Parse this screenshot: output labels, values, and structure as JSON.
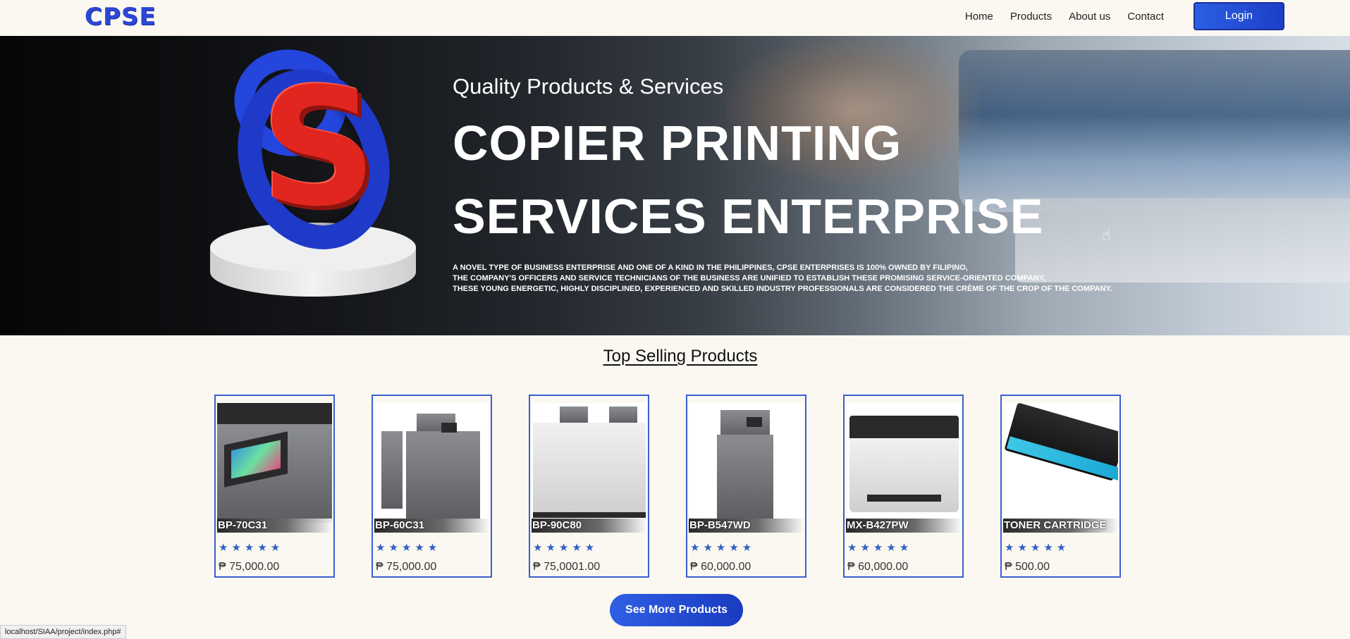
{
  "brand": {
    "logo_text": "CPSE"
  },
  "nav": {
    "links": [
      "Home",
      "Products",
      "About us",
      "Contact"
    ],
    "login_label": "Login"
  },
  "hero": {
    "subtitle": "Quality Products & Services",
    "title_line1": "COPIER PRINTING",
    "title_line2": "SERVICES ENTERPRISE",
    "description": [
      "A NOVEL TYPE OF BUSINESS ENTERPRISE AND ONE OF A KIND IN THE PHILIPPINES, CPSE ENTERPRISES IS 100% OWNED BY FILIPINO,",
      "THE COMPANY'S OFFICERS AND SERVICE TECHNICIANS OF THE BUSINESS ARE UNIFIED TO ESTABLISH THESE PROMISING SERVICE-ORIENTED COMPANY,",
      "THESE YOUNG ENERGETIC, HIGHLY DISCIPLINED, EXPERIENCED AND SKILLED INDUSTRY PROFESSIONALS ARE CONSIDERED THE CRÈME OF THE CROP OF THE COMPANY."
    ],
    "emblem_letter": "S"
  },
  "top_selling": {
    "title": "Top Selling Products",
    "products": [
      {
        "name": "BP-70C31",
        "rating": 5,
        "stars": "★★★★★",
        "price": "₱ 75,000.00"
      },
      {
        "name": "BP-60C31",
        "rating": 5,
        "stars": "★★★★★",
        "price": "₱ 75,000.00"
      },
      {
        "name": "BP-90C80",
        "rating": 5,
        "stars": "★★★★★",
        "price": "₱ 75,0001.00"
      },
      {
        "name": "BP-B547WD",
        "rating": 5,
        "stars": "★★★★★",
        "price": "₱ 60,000.00"
      },
      {
        "name": "MX-B427PW",
        "rating": 5,
        "stars": "★★★★★",
        "price": "₱ 60,000.00"
      },
      {
        "name": "TONER CARTRIDGE",
        "rating": 5,
        "stars": "★★★★★",
        "price": "₱ 500.00"
      }
    ],
    "see_more_label": "See More Products"
  },
  "status_bar": {
    "url": "localhost/SIAA/project/index.php#"
  },
  "colors": {
    "accent": "#2c47d6",
    "card_border": "#3b5fd0",
    "star": "#2f5fc4",
    "background": "#fbf8f1"
  }
}
